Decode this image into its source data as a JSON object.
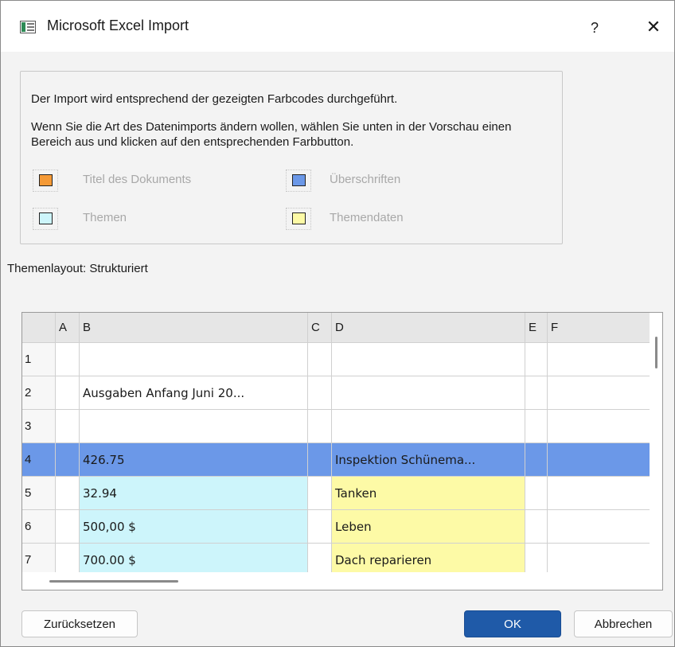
{
  "window": {
    "title": "Microsoft Excel Import",
    "help_label": "?",
    "close_label": "✕"
  },
  "legend": {
    "line1": "Der Import wird entsprechend der gezeigten Farbcodes durchgeführt.",
    "line2": "Wenn Sie die Art des Datenimports ändern wollen, wählen Sie unten in der Vorschau einen Bereich aus und klicken auf den entsprechenden Farbbutton.",
    "items": [
      {
        "label": "Titel des Dokuments",
        "color": "#f59a36"
      },
      {
        "label": "Überschriften",
        "color": "#6b98e8"
      },
      {
        "label": "Themen",
        "color": "#cdf5fb"
      },
      {
        "label": "Themendaten",
        "color": "#fdfaa6"
      }
    ]
  },
  "layout_label": "Themenlayout: Strukturiert",
  "grid": {
    "columns": [
      "A",
      "B",
      "C",
      "D",
      "E",
      "F"
    ],
    "rows": [
      {
        "num": "1",
        "A": "",
        "B": "",
        "C": "",
        "D": "",
        "E": "",
        "F": ""
      },
      {
        "num": "2",
        "A": "",
        "B": "Ausgaben Anfang Juni 20...",
        "C": "",
        "D": "",
        "E": "",
        "F": ""
      },
      {
        "num": "3",
        "A": "",
        "B": "",
        "C": "",
        "D": "",
        "E": "",
        "F": ""
      },
      {
        "num": "4",
        "A": "",
        "B": "426.75",
        "C": "",
        "D": "Inspektion  Schünema...",
        "E": "",
        "F": ""
      },
      {
        "num": "5",
        "A": "",
        "B": "32.94",
        "C": "",
        "D": "Tanken",
        "E": "",
        "F": ""
      },
      {
        "num": "6",
        "A": "",
        "B": "500,00 $",
        "C": "",
        "D": "Leben",
        "E": "",
        "F": ""
      },
      {
        "num": "7",
        "A": "",
        "B": "700.00 $",
        "C": "",
        "D": "Dach reparieren",
        "E": "",
        "F": ""
      }
    ],
    "colors": {
      "header": "#e6e6e6",
      "heading_row": "#6b98e8",
      "topic": "#cdf5fb",
      "topic_data": "#fdfaa6"
    }
  },
  "buttons": {
    "reset": "Zurücksetzen",
    "ok": "OK",
    "cancel": "Abbrechen"
  }
}
